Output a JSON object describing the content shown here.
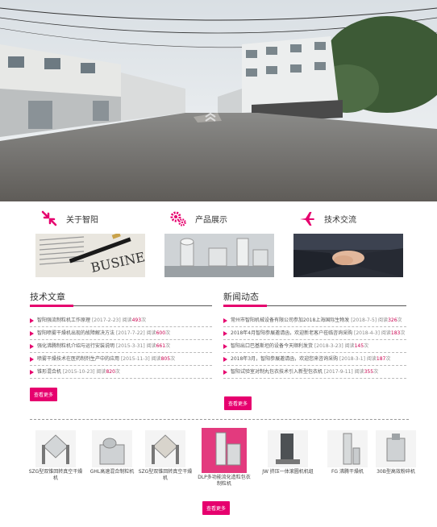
{
  "features": [
    {
      "title": "关于智阳",
      "icon": "arrows-in-icon"
    },
    {
      "title": "产品展示",
      "icon": "gears-icon"
    },
    {
      "title": "技术交流",
      "icon": "airplane-icon"
    }
  ],
  "articles": {
    "title": "技术文章",
    "items": [
      {
        "text": "智阳强流制粒机工作原理",
        "date": "[2017-2-23]",
        "hits_label": "阅读",
        "hits": "493",
        "unit": "次"
      },
      {
        "text": "智阳喷雾干燥机出现的故障解决方法",
        "date": "[2017-7-22]",
        "hits_label": "阅读",
        "hits": "600",
        "unit": "次"
      },
      {
        "text": "强化沸腾制粒机介绍与运行安装说明",
        "date": "[2015-3-31]",
        "hits_label": "阅读",
        "hits": "661",
        "unit": "次"
      },
      {
        "text": "喷雾干燥技术在医药制剂生产中的应用",
        "date": "[2015-11-3]",
        "hits_label": "阅读",
        "hits": "805",
        "unit": "次"
      },
      {
        "text": "锥形混合机",
        "date": "[2015-10-23]",
        "hits_label": "阅读",
        "hits": "820",
        "unit": "次"
      }
    ],
    "more": "查看更多"
  },
  "news": {
    "title": "新闻动态",
    "items": [
      {
        "text": "常州市智阳机械设备有限公司参加2018上海国际生物发",
        "date": "[2018-7-5]",
        "hits_label": "阅读",
        "hits": "326",
        "unit": "次"
      },
      {
        "text": "2018年4月智阳参展邀请函，欢迎新老客户莅临咨询采购",
        "date": "[2018-4-3]",
        "hits_label": "阅读",
        "hits": "183",
        "unit": "次"
      },
      {
        "text": "智阳出口巴基斯坦的设备今天顺利发货",
        "date": "[2018-3-23]",
        "hits_label": "阅读",
        "hits": "145",
        "unit": "次"
      },
      {
        "text": "2018年3月，智阳参展邀请函，欢迎您来咨询采购",
        "date": "[2018-3-1]",
        "hits_label": "阅读",
        "hits": "187",
        "unit": "次"
      },
      {
        "text": "智阳试验室对制丸包衣技术引入新型包衣机",
        "date": "[2017-9-11]",
        "hits_label": "阅读",
        "hits": "355",
        "unit": "次"
      }
    ],
    "more": "查看更多"
  },
  "products": {
    "items": [
      {
        "name": "SZG型双锥回转真空干燥机"
      },
      {
        "name": "GHL高速混合制粒机"
      },
      {
        "name": "SZG型双锥回转真空干燥机"
      },
      {
        "name": "DLP多功能流化造粒包衣制粒机"
      },
      {
        "name": "JW 挤压一体滚圆机机组"
      },
      {
        "name": "FG 沸腾干燥机"
      },
      {
        "name": "30B型高效粉碎机"
      }
    ],
    "more": "查看更多"
  },
  "colors": {
    "accent": "#e6006e"
  }
}
